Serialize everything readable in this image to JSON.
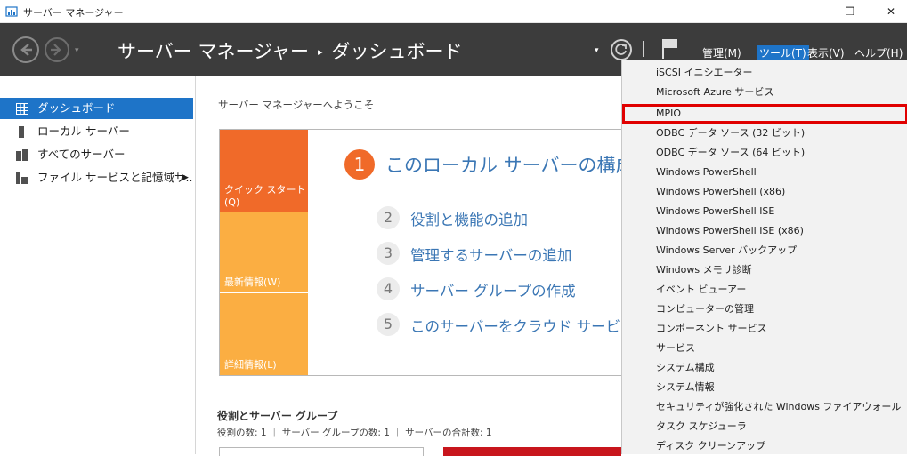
{
  "window": {
    "title": "サーバー マネージャー",
    "minimize_glyph": "—",
    "maximize_glyph": "❐",
    "close_glyph": "✕",
    "icon": "server-manager-icon"
  },
  "header": {
    "breadcrumb_root": "サーバー マネージャー",
    "breadcrumb_sep": "▸",
    "breadcrumb_page": "ダッシュボード",
    "dropdown_glyph": "▾",
    "menus": {
      "manage": "管理(M)",
      "tools": "ツール(T)",
      "view": "表示(V)",
      "help": "ヘルプ(H)"
    },
    "icons": [
      "back-icon",
      "forward-icon",
      "refresh-icon",
      "flag-icon"
    ]
  },
  "sidebar": {
    "items": [
      {
        "label": "ダッシュボード",
        "icon": "dashboard-icon"
      },
      {
        "label": "ローカル サーバー",
        "icon": "server-icon"
      },
      {
        "label": "すべてのサーバー",
        "icon": "servers-icon"
      },
      {
        "label": "ファイル サービスと記憶域サ...",
        "icon": "file-storage-icon",
        "arrow": "▶"
      }
    ]
  },
  "main": {
    "welcome": "サーバー マネージャーへようこそ",
    "tiles": {
      "quick_start": "クイック スタート(Q)",
      "whats_new": "最新情報(W)",
      "learn_more": "詳細情報(L)"
    },
    "step1": {
      "num": "1",
      "text": "このローカル サーバーの構成"
    },
    "steps": [
      {
        "num": "2",
        "text": "役割と機能の追加"
      },
      {
        "num": "3",
        "text": "管理するサーバーの追加"
      },
      {
        "num": "4",
        "text": "サーバー グループの作成"
      },
      {
        "num": "5",
        "text": "このサーバーをクラウド サービスに接"
      }
    ],
    "roles_title": "役割とサーバー グループ",
    "roles_stats": "役割の数: 1 ｜ サーバー グループの数: 1 ｜ サーバーの合計数: 1"
  },
  "tools_menu": {
    "items": [
      "iSCSI イニシエーター",
      "Microsoft Azure サービス",
      "MPIO",
      "ODBC データ ソース (32 ビット)",
      "ODBC データ ソース (64 ビット)",
      "Windows PowerShell",
      "Windows PowerShell (x86)",
      "Windows PowerShell ISE",
      "Windows PowerShell ISE (x86)",
      "Windows Server バックアップ",
      "Windows メモリ診断",
      "イベント ビューアー",
      "コンピューターの管理",
      "コンポーネント サービス",
      "サービス",
      "システム構成",
      "システム情報",
      "セキュリティが強化された Windows ファイアウォール",
      "タスク スケジューラ",
      "ディスク クリーンアップ"
    ],
    "highlighted": "MPIO"
  },
  "colors": {
    "header_bg": "#3c3c3c",
    "accent_blue": "#1e74c8",
    "orange": "#f06a29",
    "amber": "#fbae42",
    "highlight_red": "#e00000",
    "link_blue": "#3a76b4"
  }
}
